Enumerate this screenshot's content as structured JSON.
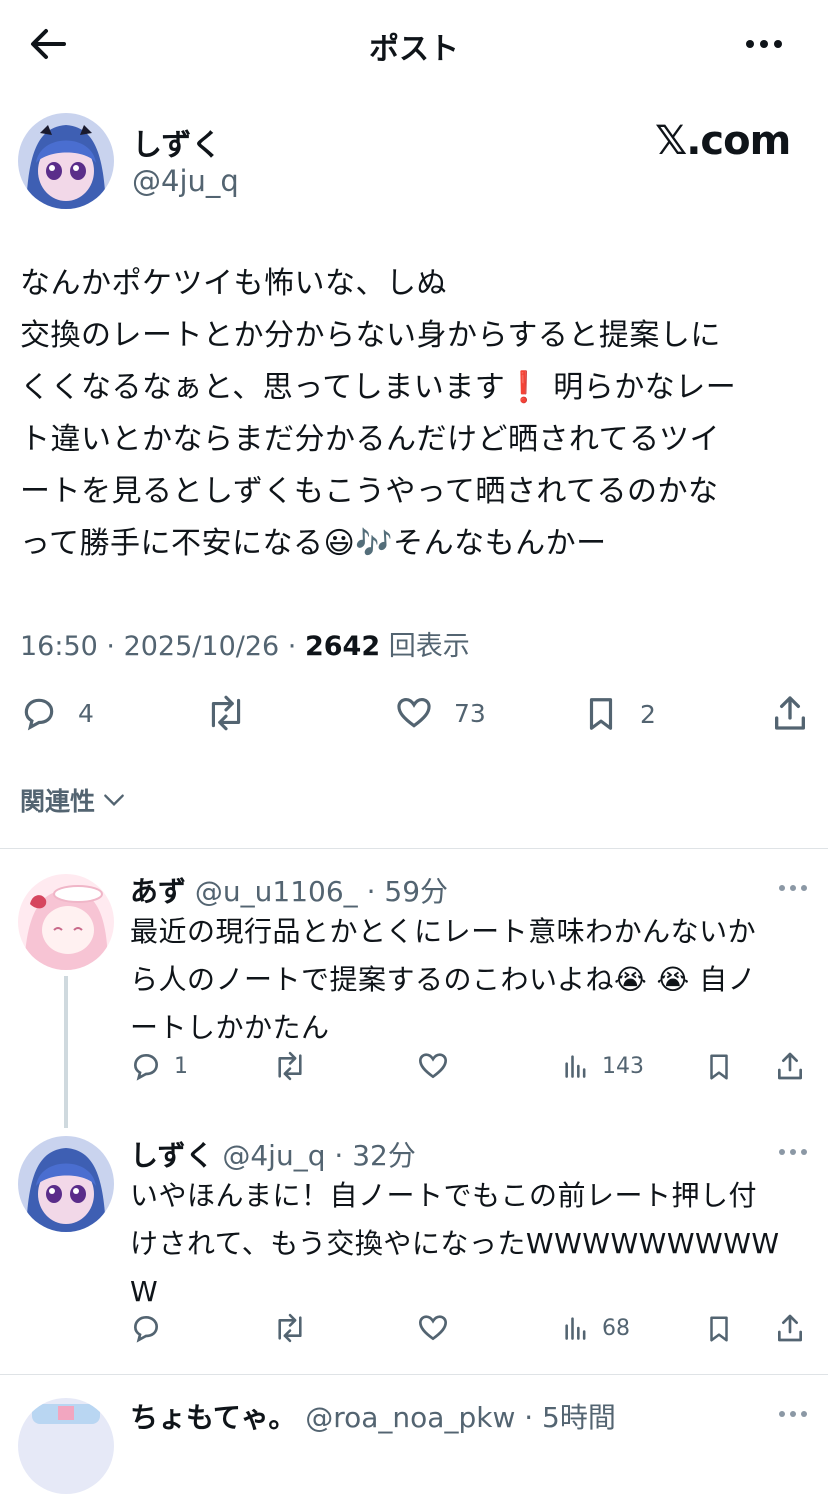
{
  "header": {
    "title": "ポスト",
    "back_icon": "arrow-left-icon",
    "more_icon": "more-dots-icon"
  },
  "post": {
    "display_name": "しずく",
    "handle": "@4ju_q",
    "brand": "𝕏.com",
    "text": "なんかポケツイも怖いな、しぬ\n交換のレートとか分からない身からすると提案しに\nくくなるなぁと、思ってしまいます❗ 明らかなレー\nト違いとかならまだ分かるんだけど晒されてるツイ\nートを見るとしずくもこうやって晒されてるのかな\nって勝手に不安になる😃🎶そんなもんかー",
    "time": "16:50",
    "date": "2025/10/26",
    "views_count": "2642",
    "views_label": "回表示",
    "replies": "4",
    "likes": "73",
    "bookmarks": "2"
  },
  "relevance": {
    "label": "関連性"
  },
  "replies": [
    {
      "display_name": "あず",
      "handle": "@u_u1106_",
      "time": "59分",
      "text": "最近の現行品とかとくにレート意味わかんないか\nら人のノートで提案するのこわいよね😭 😭 自ノ\nートしかかたん",
      "replies": "1",
      "views": "143"
    },
    {
      "display_name": "しずく",
      "handle": "@4ju_q",
      "time": "32分",
      "text": "いやほんまに！自ノートでもこの前レート押し付\nけされて、もう交換やになったWWWWWWWWW\nW",
      "views": "68"
    },
    {
      "display_name": "ちょもてゃ。",
      "handle": "@roa_noa_pkw",
      "time": "5時間"
    }
  ],
  "colors": {
    "text": "#0f1419",
    "secondary": "#536471",
    "divider": "#dfe3e6"
  }
}
